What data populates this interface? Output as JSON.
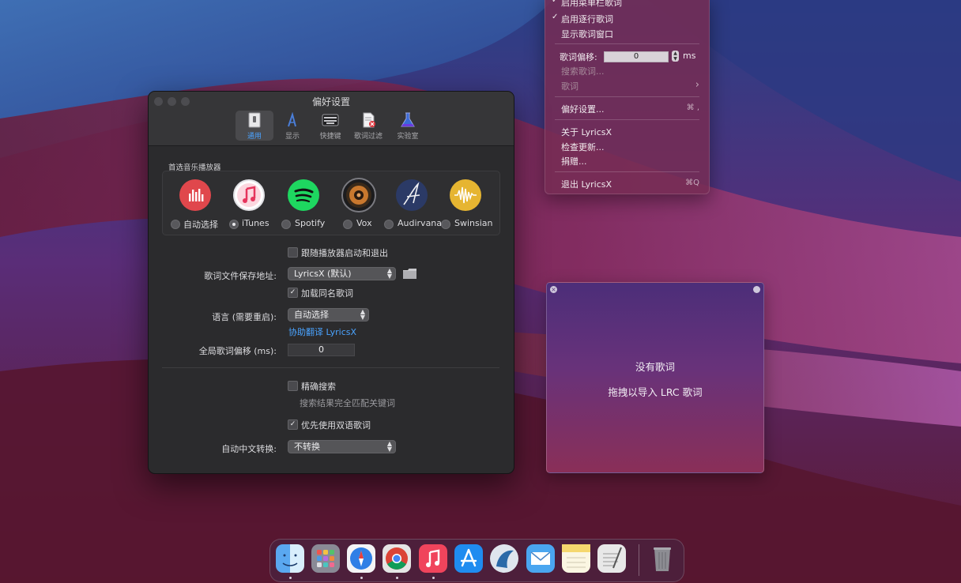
{
  "menu": {
    "items": [
      {
        "label": "启用菜单栏歌词",
        "checked": true
      },
      {
        "label": "启用逐行歌词",
        "checked": true
      },
      {
        "label": "显示歌词窗口",
        "checked": false
      }
    ],
    "offset_label": "歌词偏移:",
    "offset_value": "0",
    "offset_unit": "ms",
    "search_lyrics": "搜索歌词...",
    "lyrics": "歌词",
    "lyrics_arrow": "›",
    "preferences": "偏好设置...",
    "preferences_shortcut": "⌘ ,",
    "about": "关于 LyricsX",
    "check_updates": "检查更新...",
    "donate": "捐赠...",
    "quit": "退出 LyricsX",
    "quit_shortcut": "⌘Q"
  },
  "prefs": {
    "title": "偏好设置",
    "tabs": [
      {
        "label": "通用",
        "icon": "general-switch-icon",
        "active": true
      },
      {
        "label": "显示",
        "icon": "display-font-icon",
        "active": false
      },
      {
        "label": "快捷键",
        "icon": "keyboard-icon",
        "active": false
      },
      {
        "label": "歌词过滤",
        "icon": "filter-document-icon",
        "active": false
      },
      {
        "label": "实验室",
        "icon": "flask-icon",
        "active": false
      }
    ],
    "player_section_label": "首选音乐播放器",
    "players": [
      {
        "label": "自动选择",
        "icon": "auto-select-icon",
        "color": "#e0474c",
        "selected": false
      },
      {
        "label": "iTunes",
        "icon": "itunes-icon",
        "color": "#f25f7e",
        "selected": true
      },
      {
        "label": "Spotify",
        "icon": "spotify-icon",
        "color": "#1ed760",
        "selected": false
      },
      {
        "label": "Vox",
        "icon": "vox-icon",
        "color": "#c9782e",
        "selected": false
      },
      {
        "label": "Audirvana",
        "icon": "audirvana-icon",
        "color": "#2b3a66",
        "selected": false
      },
      {
        "label": "Swinsian",
        "icon": "swinsian-icon",
        "color": "#e6b531",
        "selected": false
      }
    ],
    "launch_with_player": {
      "label": "跟随播放器启动和退出",
      "checked": false
    },
    "save_location_label": "歌词文件保存地址:",
    "save_location_value": "LyricsX (默认)",
    "load_same_name": {
      "label": "加载同名歌词",
      "checked": true
    },
    "language_label": "语言 (需要重启):",
    "language_value": "自动选择",
    "help_translate": "协助翻译 LyricsX",
    "global_offset_label": "全局歌词偏移 (ms):",
    "global_offset_value": "0",
    "strict_search": {
      "label": "精确搜索",
      "checked": false
    },
    "strict_search_desc": "搜索结果完全匹配关键词",
    "prefer_bilingual": {
      "label": "优先使用双语歌词",
      "checked": true
    },
    "chinese_conversion_label": "自动中文转换:",
    "chinese_conversion_value": "不转换"
  },
  "lyrics_window": {
    "no_lyrics": "没有歌词",
    "drag_hint": "拖拽以导入 LRC 歌词"
  },
  "dock": {
    "apps": [
      {
        "name": "finder-icon",
        "color": "#3d8fe0",
        "running": true
      },
      {
        "name": "launchpad-icon",
        "color": "#8a8a96",
        "running": false
      },
      {
        "name": "safari-icon",
        "color": "#2f7fe6",
        "running": true
      },
      {
        "name": "chrome-icon",
        "color": "#e5e5e5",
        "running": true
      },
      {
        "name": "music-icon",
        "color": "#f0445c",
        "running": true
      },
      {
        "name": "app-store-icon",
        "color": "#1f8cf0",
        "running": false
      },
      {
        "name": "lyricsx-icon",
        "color": "#5aa0d8",
        "running": false
      },
      {
        "name": "mail-icon",
        "color": "#4aa6f0",
        "running": false
      },
      {
        "name": "notes-icon",
        "color": "#f5d76e",
        "running": false
      },
      {
        "name": "textedit-icon",
        "color": "#e8e8e8",
        "running": false
      },
      {
        "name": "trash-icon",
        "color": "#8d8d93",
        "running": false
      }
    ]
  }
}
